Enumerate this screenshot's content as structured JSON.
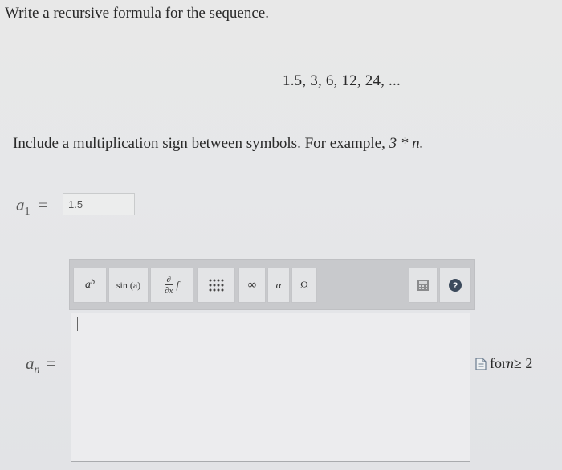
{
  "question": "Write a recursive formula for the sequence.",
  "sequence": "1.5, 3, 6, 12, 24, ...",
  "instruction": {
    "text": "Include a multiplication sign between symbols. For example, ",
    "example": "3 * n."
  },
  "a1": {
    "label_var": "a",
    "label_sub": "1",
    "equals": "=",
    "value": "1.5"
  },
  "toolbar": {
    "power_label": "ab",
    "sin_label": "sin (a)",
    "partial_top": "∂",
    "partial_bottom": "∂x",
    "partial_f": "f",
    "infinity": "∞",
    "alpha": "α",
    "omega": "Ω",
    "keyboard_icon": "keyboard-icon",
    "help_icon": "help-icon"
  },
  "an": {
    "label_var": "a",
    "label_sub": "n",
    "equals": "="
  },
  "for_note": {
    "prefix": "for ",
    "var": "n",
    "condition": " ≥ 2"
  }
}
